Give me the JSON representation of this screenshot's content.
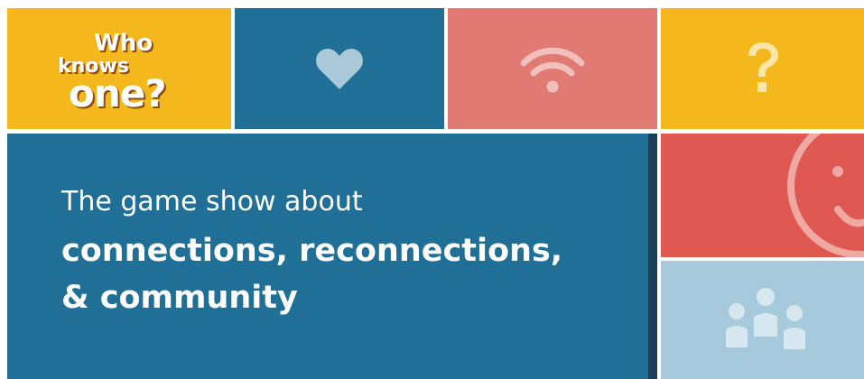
{
  "logo": {
    "line1": "Who",
    "line2": "knows",
    "line3": "one?"
  },
  "headline": {
    "line1": "The game show about",
    "line2": "connections, reconnections,",
    "line3": "& community"
  },
  "tiles": {
    "heart": "heart-icon",
    "wifi": "wifi-icon",
    "question": "question-icon",
    "smile": "smile-icon",
    "people": "people-icon"
  },
  "colors": {
    "yellow": "#f4b71c",
    "blue": "#206f97",
    "pink": "#e27a74",
    "red": "#e05852",
    "light_blue": "#a6cadb"
  }
}
